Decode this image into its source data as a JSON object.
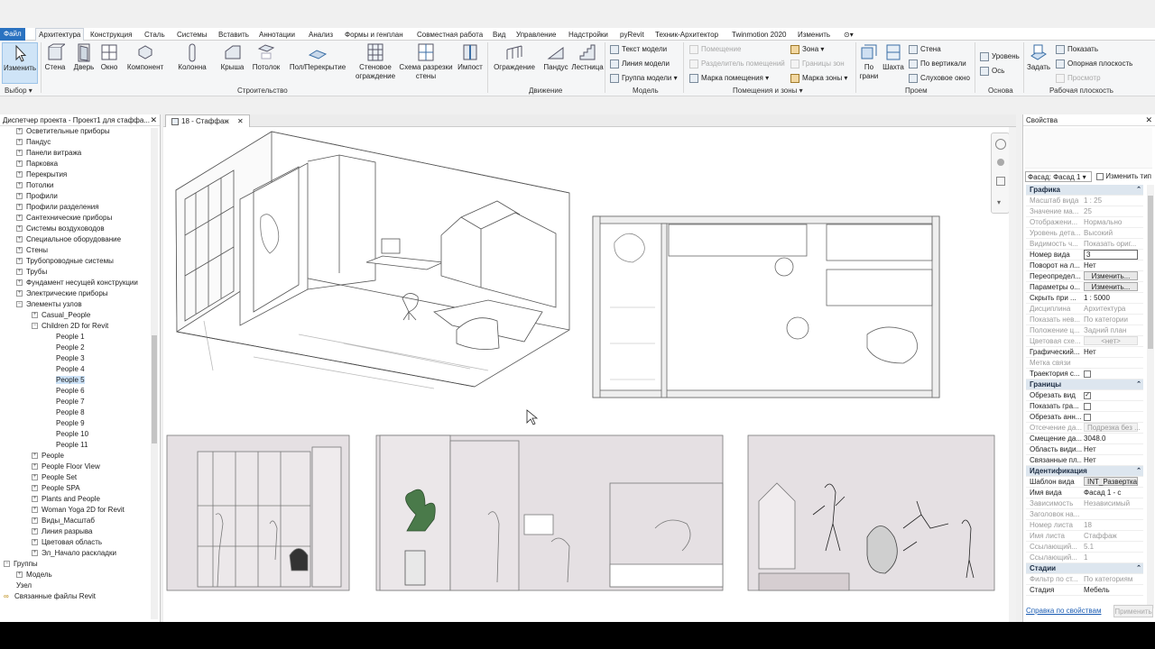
{
  "menu": {
    "items": [
      "Файл",
      "Архитектура",
      "Конструкция",
      "Сталь",
      "Системы",
      "Вставить",
      "Аннотации",
      "Анализ",
      "Формы и генплан",
      "Совместная работа",
      "Вид",
      "Управление",
      "Надстройки",
      "pyRevit",
      "Техник-Архитектор",
      "Twinmotion 2020",
      "Изменить"
    ]
  },
  "ribbon": {
    "select_big": "Изменить",
    "select_panel": "Выбор",
    "build": [
      "Стена",
      "Дверь",
      "Окно",
      "Компонент",
      "Колонна",
      "Крыша",
      "Потолок",
      "Пол/Перекрытие",
      "Стеновое ограждение",
      "Схема разрезки стены",
      "Импост"
    ],
    "build_panel": "Строительство",
    "move": [
      "Ограждение",
      "Пандус",
      "Лестница"
    ],
    "move_panel": "Движение",
    "model": [
      "Текст модели",
      "Линия модели",
      "Группа модели"
    ],
    "model_panel": "Модель",
    "rooms": [
      "Помещение",
      "Разделитель помещений",
      "Марка помещения",
      "Зона",
      "Границы зон",
      "Марка зоны"
    ],
    "rooms_panel": "Помещения и зоны",
    "opening": [
      "По грани",
      "Шахта",
      "Стена",
      "По вертикали",
      "Слуховое окно"
    ],
    "opening_panel": "Проем",
    "datum": [
      "Уровень",
      "Ось"
    ],
    "datum_panel": "Основа",
    "workplane": [
      "Задать",
      "Показать",
      "Опорная плоскость",
      "Просмотр"
    ],
    "workplane_panel": "Рабочая плоскость"
  },
  "browser": {
    "title": "Диспетчер проекта - Проект1 для стаффа...",
    "items": [
      {
        "t": "Осветительные приборы",
        "l": 1,
        "g": "+"
      },
      {
        "t": "Пандус",
        "l": 1,
        "g": "+"
      },
      {
        "t": "Панели витража",
        "l": 1,
        "g": "+"
      },
      {
        "t": "Парковка",
        "l": 1,
        "g": "+"
      },
      {
        "t": "Перекрытия",
        "l": 1,
        "g": "+"
      },
      {
        "t": "Потолки",
        "l": 1,
        "g": "+"
      },
      {
        "t": "Профили",
        "l": 1,
        "g": "+"
      },
      {
        "t": "Профили разделения",
        "l": 1,
        "g": "+"
      },
      {
        "t": "Сантехнические приборы",
        "l": 1,
        "g": "+"
      },
      {
        "t": "Системы воздуховодов",
        "l": 1,
        "g": "+"
      },
      {
        "t": "Специальное оборудование",
        "l": 1,
        "g": "+"
      },
      {
        "t": "Стены",
        "l": 1,
        "g": "+"
      },
      {
        "t": "Трубопроводные системы",
        "l": 1,
        "g": "+"
      },
      {
        "t": "Трубы",
        "l": 1,
        "g": "+"
      },
      {
        "t": "Фундамент несущей конструкции",
        "l": 1,
        "g": "+"
      },
      {
        "t": "Электрические приборы",
        "l": 1,
        "g": "+"
      },
      {
        "t": "Элементы узлов",
        "l": 1,
        "g": "-"
      },
      {
        "t": "Casual_People",
        "l": 2,
        "g": "+"
      },
      {
        "t": "Children 2D for Revit",
        "l": 2,
        "g": "-"
      },
      {
        "t": "People 1",
        "l": 3,
        "g": ""
      },
      {
        "t": "People 2",
        "l": 3,
        "g": ""
      },
      {
        "t": "People 3",
        "l": 3,
        "g": ""
      },
      {
        "t": "People 4",
        "l": 3,
        "g": ""
      },
      {
        "t": "People 5",
        "l": 3,
        "g": "",
        "sel": true
      },
      {
        "t": "People 6",
        "l": 3,
        "g": ""
      },
      {
        "t": "People 7",
        "l": 3,
        "g": ""
      },
      {
        "t": "People 8",
        "l": 3,
        "g": ""
      },
      {
        "t": "People 9",
        "l": 3,
        "g": ""
      },
      {
        "t": "People 10",
        "l": 3,
        "g": ""
      },
      {
        "t": "People 11",
        "l": 3,
        "g": ""
      },
      {
        "t": "People",
        "l": 2,
        "g": "+"
      },
      {
        "t": "People Floor View",
        "l": 2,
        "g": "+"
      },
      {
        "t": "People Set",
        "l": 2,
        "g": "+"
      },
      {
        "t": "People SPA",
        "l": 2,
        "g": "+"
      },
      {
        "t": "Plants and People",
        "l": 2,
        "g": "+"
      },
      {
        "t": "Woman Yoga 2D for Revit",
        "l": 2,
        "g": "+"
      },
      {
        "t": "Виды_Масштаб",
        "l": 2,
        "g": "+"
      },
      {
        "t": "Линия разрыва",
        "l": 2,
        "g": "+"
      },
      {
        "t": "Цветовая область",
        "l": 2,
        "g": "+"
      },
      {
        "t": "Эл_Начало раскладки",
        "l": 2,
        "g": "+"
      },
      {
        "t": "Группы",
        "l": 0,
        "g": "-"
      },
      {
        "t": "Модель",
        "l": 1,
        "g": "+"
      },
      {
        "t": "Узел",
        "l": 1,
        "g": ""
      },
      {
        "t": "Связанные файлы Revit",
        "l": 0,
        "g": "oo"
      }
    ]
  },
  "view_tab": "18 - Стаффаж",
  "props": {
    "title": "Свойства",
    "type_selector": "Фасад: Фасад 1",
    "edit_type": "Изменить тип",
    "rows": [
      {
        "s": "Графика"
      },
      {
        "k": "Масштаб вида",
        "v": "1 : 25",
        "d": true
      },
      {
        "k": "Значение ма...",
        "v": "25",
        "d": true
      },
      {
        "k": "Отображени...",
        "v": "Нормально",
        "d": true
      },
      {
        "k": "Уровень дета...",
        "v": "Высокий",
        "d": true
      },
      {
        "k": "Видимость ч...",
        "v": "Показать ориг...",
        "d": true
      },
      {
        "k": "Номер вида",
        "v": "3",
        "w": "input"
      },
      {
        "k": "Поворот на л...",
        "v": "Нет"
      },
      {
        "k": "Переопредел...",
        "v": "Изменить...",
        "w": "btn"
      },
      {
        "k": "Параметры о...",
        "v": "Изменить...",
        "w": "btn"
      },
      {
        "k": "Скрыть при ...",
        "v": "1 : 5000"
      },
      {
        "k": "Дисциплина",
        "v": "Архитектура",
        "d": true
      },
      {
        "k": "Показать нев...",
        "v": "По категории",
        "d": true
      },
      {
        "k": "Положение ц...",
        "v": "Задний план",
        "d": true
      },
      {
        "k": "Цветовая схе...",
        "v": "<нет>",
        "d": true,
        "w": "btnd"
      },
      {
        "k": "Графический...",
        "v": "Нет"
      },
      {
        "k": "Метка связи",
        "v": "",
        "d": true
      },
      {
        "k": "Траектория с...",
        "v": "",
        "w": "chk"
      },
      {
        "s": "Границы"
      },
      {
        "k": "Обрезать вид",
        "v": "✓",
        "w": "chk"
      },
      {
        "k": "Показать гра...",
        "v": "",
        "w": "chk"
      },
      {
        "k": "Обрезать анн...",
        "v": "",
        "w": "chk"
      },
      {
        "k": "Отсечение да...",
        "v": "Подрезка без ...",
        "d": true,
        "w": "btnd"
      },
      {
        "k": "Смещение да...",
        "v": "3048.0"
      },
      {
        "k": "Область види...",
        "v": "Нет"
      },
      {
        "k": "Связанные пл...",
        "v": "Нет"
      },
      {
        "s": "Идентификация"
      },
      {
        "k": "Шаблон вида",
        "v": "INT_Развертка",
        "w": "btn"
      },
      {
        "k": "Имя вида",
        "v": "Фасад 1 - с"
      },
      {
        "k": "Зависимость",
        "v": "Независимый",
        "d": true
      },
      {
        "k": "Заголовок на...",
        "v": "",
        "d": true
      },
      {
        "k": "Номер листа",
        "v": "18",
        "d": true
      },
      {
        "k": "Имя листа",
        "v": "Стаффаж",
        "d": true
      },
      {
        "k": "Ссылающий...",
        "v": "5.1",
        "d": true
      },
      {
        "k": "Ссылающий...",
        "v": "1",
        "d": true
      },
      {
        "s": "Стадии"
      },
      {
        "k": "Фильтр по ст...",
        "v": "По категориям",
        "d": true
      },
      {
        "k": "Стадия",
        "v": "Мебель"
      }
    ],
    "help_link": "Справка по свойствам",
    "apply": "Применить"
  }
}
